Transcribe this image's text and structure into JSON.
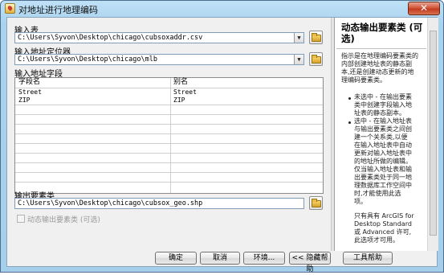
{
  "window": {
    "title": "对地址进行地理编码",
    "close_glyph": "✕"
  },
  "inputs": {
    "input_table_label": "输入表",
    "input_table_value": "C:\\Users\\Syvon\\Desktop\\chicago\\cubsoxaddr.csv",
    "locator_label": "输入地址定位器",
    "locator_value": "C:\\Users\\Syvon\\Desktop\\chicago\\mlb",
    "fields_label": "输入地址字段",
    "output_label": "输出要素类",
    "output_value": "C:\\Users\\Syvon\\Desktop\\chicago\\cubsox_geo.shp",
    "dynamic_checkbox_label": "动态输出要素类 (可选)",
    "dynamic_checked": false
  },
  "fields_table": {
    "headers": [
      "字段名",
      "别名"
    ],
    "rows": [
      [
        "Street",
        "Street"
      ],
      [
        "ZIP",
        "ZIP"
      ]
    ]
  },
  "buttons": {
    "ok": "确定",
    "cancel": "取消",
    "environments": "环境...",
    "hide_help": "<< 隐藏帮助",
    "tool_help": "工具帮助"
  },
  "help": {
    "title": "动态输出要素类 (可选)",
    "intro": [
      "指示是在地理编码要素类的",
      "内部创建地址表的静态副",
      "本,还是创建动态更新的地",
      "理编码要素类。"
    ],
    "bullet1": [
      "未选中 - 在输出要素",
      "类中创建字段输入地",
      "址表的静态副本。"
    ],
    "bullet2": [
      "选中 - 在输入地址表",
      "与输出要素类之间创",
      "建一个关系类,以便",
      "在输入地址表中自动",
      "更新对输入地址表中",
      "的地址所做的编辑。",
      "仅当输入地址表和输",
      "出要素类处于同一地",
      "理数据库工作空间中",
      "时,才能使用此选",
      "项。"
    ],
    "note": [
      "只有具有 ArcGIS for",
      "Desktop Standard",
      "或 Advanced 许可,",
      "此选项才可用。"
    ]
  },
  "icons": {
    "app": "geocode-app-icon",
    "browse": "folder-open-icon",
    "dropdown": "chevron-down-icon"
  }
}
